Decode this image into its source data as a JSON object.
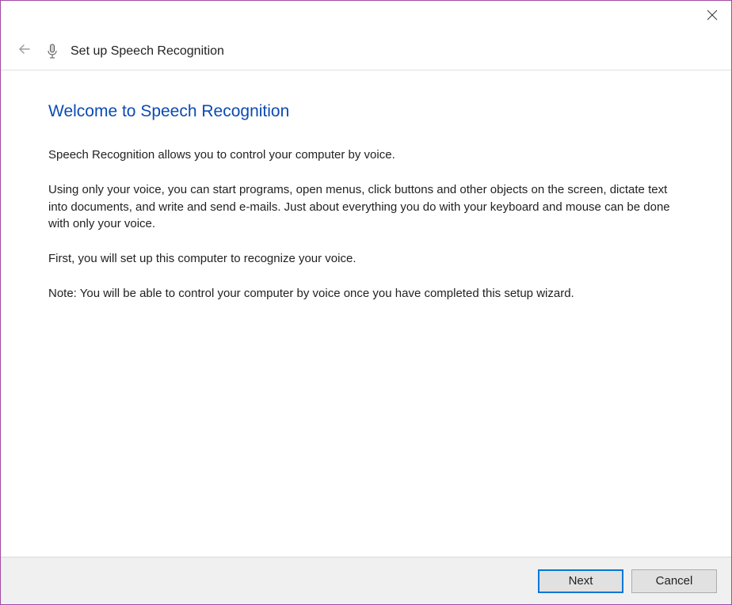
{
  "header": {
    "title": "Set up Speech Recognition"
  },
  "content": {
    "heading": "Welcome to Speech Recognition",
    "p1": "Speech Recognition allows you to control your computer by voice.",
    "p2": "Using only your voice, you can start programs, open menus, click buttons and other objects on the screen, dictate text into documents, and write and send e-mails. Just about everything you do with your keyboard and mouse can be done with only your voice.",
    "p3": "First, you will set up this computer to recognize your voice.",
    "p4": "Note: You will be able to control your computer by voice once you have completed this setup wizard."
  },
  "footer": {
    "next_label": "Next",
    "cancel_label": "Cancel"
  }
}
